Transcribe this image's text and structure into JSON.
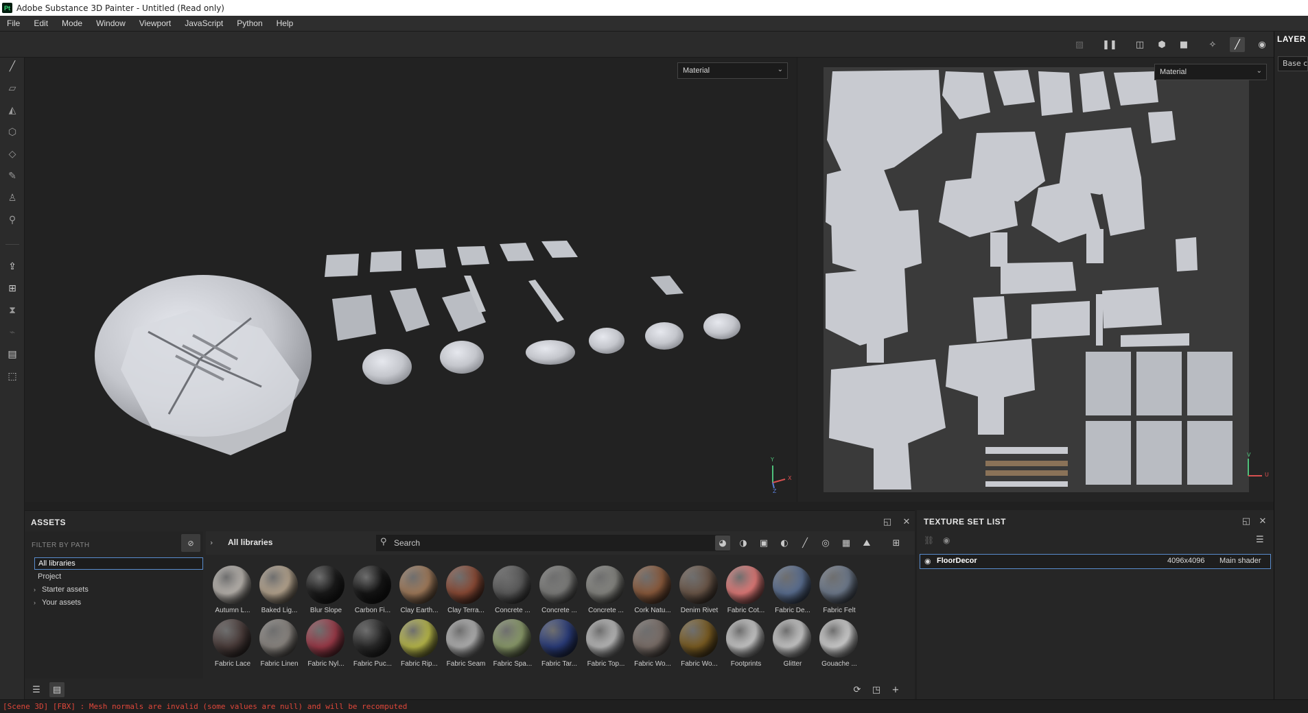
{
  "window": {
    "title": "Adobe Substance 3D Painter - Untitled (Read only)",
    "logo_text": "Pt"
  },
  "menu": [
    "File",
    "Edit",
    "Mode",
    "Window",
    "Viewport",
    "JavaScript",
    "Python",
    "Help"
  ],
  "viewport_3d": {
    "mode_select": "Material",
    "axis": {
      "y": "Y",
      "x": "X",
      "z": "Z"
    }
  },
  "viewport_2d": {
    "mode_select": "Material",
    "axis": {
      "v": "V",
      "u": "U"
    }
  },
  "right_panel": {
    "tab": "LAYER",
    "base_select": "Base c"
  },
  "assets": {
    "title": "ASSETS",
    "filter_label": "FILTER BY PATH",
    "libraries": [
      {
        "label": "All libraries",
        "expandable": false,
        "selected": true
      },
      {
        "label": "Project",
        "expandable": false,
        "selected": false
      },
      {
        "label": "Starter assets",
        "expandable": true,
        "selected": false
      },
      {
        "label": "Your assets",
        "expandable": true,
        "selected": false
      }
    ],
    "breadcrumb": "All libraries",
    "search_placeholder": "Search",
    "row1": [
      {
        "name": "Autumn L...",
        "color": "#b8b3ad"
      },
      {
        "name": "Baked Lig...",
        "color": "#b5a48e"
      },
      {
        "name": "Blur Slope",
        "color": "#1a1a1a"
      },
      {
        "name": "Carbon Fi...",
        "color": "#151515"
      },
      {
        "name": "Clay Earth...",
        "color": "#a07a5a"
      },
      {
        "name": "Clay Terra...",
        "color": "#8a4a35"
      },
      {
        "name": "Concrete ...",
        "color": "#5a5a5a"
      },
      {
        "name": "Concrete ...",
        "color": "#7c7c7a"
      },
      {
        "name": "Concrete ...",
        "color": "#858580"
      },
      {
        "name": "Cork Natu...",
        "color": "#8a5a3c"
      },
      {
        "name": "Denim Rivet",
        "color": "#6a5648"
      },
      {
        "name": "Fabric Cot...",
        "color": "#e07a78"
      },
      {
        "name": "Fabric De...",
        "color": "#5a6e90"
      },
      {
        "name": "Fabric Felt",
        "color": "#6e7a8c"
      }
    ],
    "row2": [
      {
        "name": "Fabric Lace",
        "color": "#4a3c3a"
      },
      {
        "name": "Fabric Linen",
        "color": "#8a8580"
      },
      {
        "name": "Fabric Nyl...",
        "color": "#9a3a48"
      },
      {
        "name": "Fabric Puc...",
        "color": "#2a2a2a"
      },
      {
        "name": "Fabric Rip...",
        "color": "#b8b84a"
      },
      {
        "name": "Fabric Seam",
        "color": "#b0b0b0"
      },
      {
        "name": "Fabric Spa...",
        "color": "#8a9a6a"
      },
      {
        "name": "Fabric Tar...",
        "color": "#2a3c7a"
      },
      {
        "name": "Fabric Top...",
        "color": "#b8b8b8"
      },
      {
        "name": "Fabric Wo...",
        "color": "#7a6e68"
      },
      {
        "name": "Fabric Wo...",
        "color": "#7a5c22"
      },
      {
        "name": "Footprints",
        "color": "#c8c8c8"
      },
      {
        "name": "Glitter",
        "color": "#c8c8c8"
      },
      {
        "name": "Gouache ...",
        "color": "#d0d0d0"
      }
    ]
  },
  "texture_set_list": {
    "title": "TEXTURE SET LIST",
    "rows": [
      {
        "name": "FloorDecor",
        "resolution": "4096x4096",
        "shader": "Main shader"
      }
    ]
  },
  "status": "[Scene 3D] [FBX] : Mesh normals are invalid (some values are null) and will be recomputed",
  "colors": {
    "accent": "#5a8dcf",
    "error": "#e0473a",
    "mesh": "#d2d4da"
  }
}
